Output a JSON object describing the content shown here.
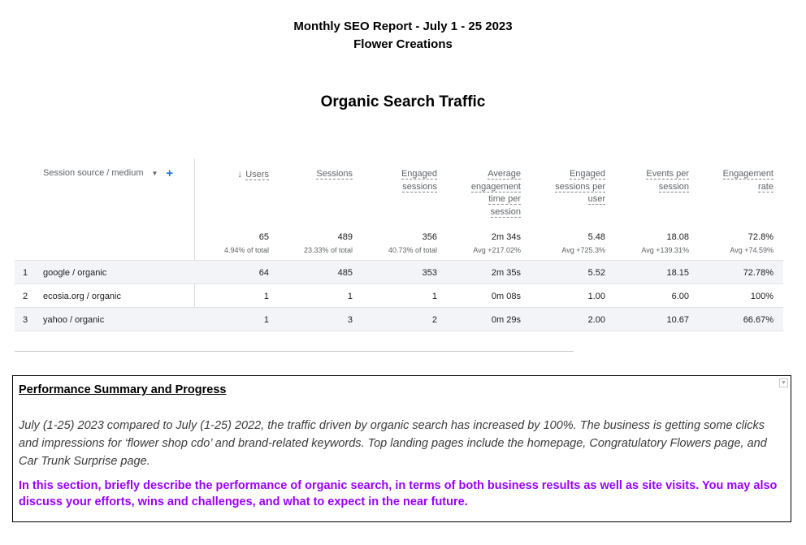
{
  "report": {
    "title": "Monthly SEO Report - July 1 - 25 2023",
    "client": "Flower Creations"
  },
  "section_title": "Organic Search Traffic",
  "table": {
    "dimension_header": "Session source / medium",
    "columns": [
      {
        "key": "users",
        "label_lines": [
          "Users"
        ],
        "sorted_desc": true,
        "total": "65",
        "total_sub": "4.94% of total"
      },
      {
        "key": "sessions",
        "label_lines": [
          "Sessions"
        ],
        "total": "489",
        "total_sub": "23.33% of total"
      },
      {
        "key": "engaged_sessions",
        "label_lines": [
          "Engaged",
          "sessions"
        ],
        "total": "356",
        "total_sub": "40.73% of total"
      },
      {
        "key": "avg_engagement_time",
        "label_lines": [
          "Average",
          "engagement",
          "time per",
          "session"
        ],
        "total": "2m 34s",
        "total_sub": "Avg +217.02%"
      },
      {
        "key": "engaged_sessions_per_user",
        "label_lines": [
          "Engaged",
          "sessions per",
          "user"
        ],
        "total": "5.48",
        "total_sub": "Avg +725.3%"
      },
      {
        "key": "events_per_session",
        "label_lines": [
          "Events per",
          "session"
        ],
        "total": "18.08",
        "total_sub": "Avg +139.31%"
      },
      {
        "key": "engagement_rate",
        "label_lines": [
          "Engagement",
          "rate"
        ],
        "total": "72.8%",
        "total_sub": "Avg +74.59%"
      }
    ],
    "rows": [
      {
        "index": "1",
        "source": "google / organic",
        "values": [
          "64",
          "485",
          "353",
          "2m 35s",
          "5.52",
          "18.15",
          "72.78%"
        ]
      },
      {
        "index": "2",
        "source": "ecosia.org / organic",
        "values": [
          "1",
          "1",
          "1",
          "0m 08s",
          "1.00",
          "6.00",
          "100%"
        ]
      },
      {
        "index": "3",
        "source": "yahoo / organic",
        "values": [
          "1",
          "3",
          "2",
          "0m 29s",
          "2.00",
          "10.67",
          "66.67%"
        ]
      }
    ]
  },
  "summary": {
    "title": "Performance Summary and Progress",
    "body": "July (1-25) 2023 compared to July (1-25) 2022, the traffic driven by organic search has increased by 100%. The business is getting some clicks and impressions for ‘flower shop cdo’ and brand-related keywords. Top landing pages include the homepage, Congratulatory Flowers page, and Car Trunk Surprise page.",
    "instructions": "In this section, briefly describe the performance of organic search, in terms of both business results as well as site visits. You may also discuss your efforts, wins and challenges, and what to expect in the near future."
  },
  "icons": {
    "sort": "arrow-down-icon",
    "dimension_menu": "caret-down-icon",
    "add_dimension": "plus-icon",
    "scroll": "chevron-down-icon"
  },
  "colors": {
    "accent": "#1a73e8",
    "instruction_text": "#9900ff",
    "row_highlight": "#f3f4f8"
  }
}
